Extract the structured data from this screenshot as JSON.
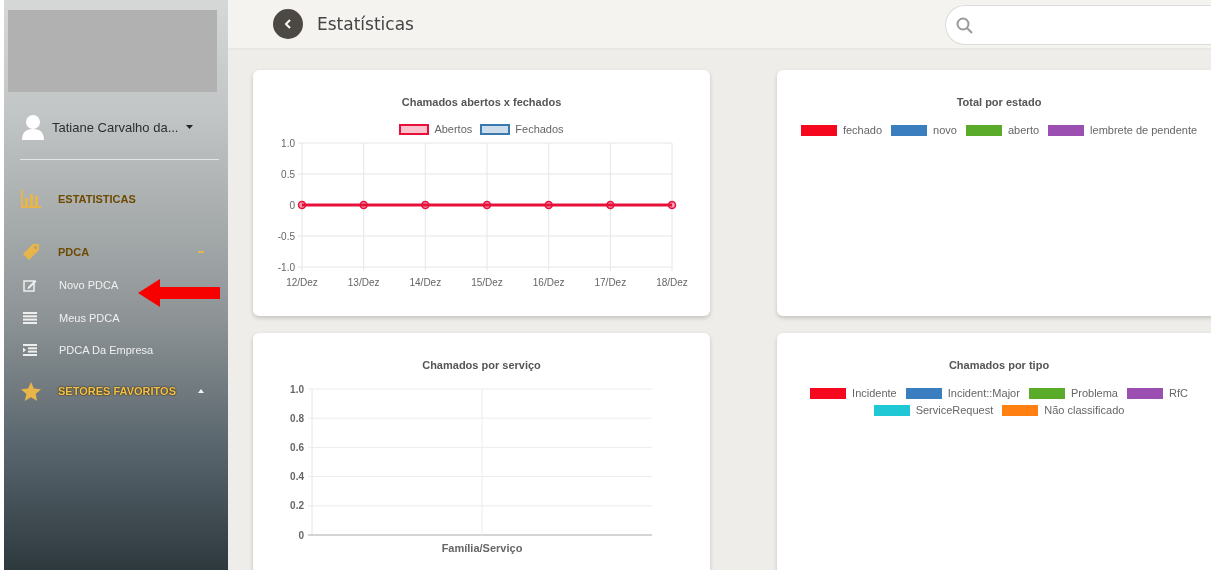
{
  "sidebar": {
    "user": {
      "name": "Tatiane Carvalho da..."
    },
    "items": [
      {
        "kind": "section",
        "label": "ESTATISTICAS"
      },
      {
        "kind": "section",
        "label": "PDCA",
        "expanded": true
      },
      {
        "kind": "link",
        "label": "Novo PDCA"
      },
      {
        "kind": "link",
        "label": "Meus PDCA"
      },
      {
        "kind": "link",
        "label": "PDCA Da Empresa"
      },
      {
        "kind": "section",
        "label": "SETORES FAVORITOS",
        "expanded": false
      }
    ]
  },
  "header": {
    "title": "Estatísticas"
  },
  "cards": [
    {
      "kind": "chart",
      "chart_data": {
        "type": "line",
        "title": "Chamados abertos x fechados",
        "categories": [
          "12/Dez",
          "13/Dez",
          "14/Dez",
          "15/Dez",
          "16/Dez",
          "17/Dez",
          "18/Dez"
        ],
        "ylim": [
          -1,
          1
        ],
        "yticks": [
          {
            "value": 1,
            "label": "1.0"
          },
          {
            "value": 0.5,
            "label": "0.5"
          },
          0,
          {
            "value": -0.5,
            "label": "-0.5"
          },
          {
            "value": -1,
            "label": "-1.0"
          }
        ],
        "grid": true,
        "legend": true,
        "series": [
          {
            "name": "Abertos",
            "color": "#e8103a",
            "marker": true,
            "values": [
              0,
              0,
              0,
              0,
              0,
              0,
              0
            ]
          },
          {
            "name": "Fechados",
            "color": "#3a78b0",
            "marker": true,
            "values": [
              null,
              null,
              null,
              null,
              null,
              null,
              null
            ]
          }
        ]
      }
    },
    {
      "kind": "legend",
      "title": "Total por estado",
      "legend": [
        {
          "label": "fechado",
          "color": "#f5081e"
        },
        {
          "label": "novo",
          "color": "#3a7ebf"
        },
        {
          "label": "aberto",
          "color": "#5aab2a"
        },
        {
          "label": "lembrete de pendente",
          "color": "#9b4fb0"
        }
      ]
    },
    {
      "kind": "chart",
      "chart_data": {
        "type": "bar",
        "title": "Chamados por serviço",
        "categories": [
          "Família/Serviço"
        ],
        "values": [
          0
        ],
        "grid": true,
        "ylim": [
          0,
          1
        ],
        "yticks": [
          {
            "value": 1,
            "label": "1.0"
          },
          {
            "value": 0.8,
            "label": "0.8"
          },
          {
            "value": 0.6,
            "label": "0.6"
          },
          {
            "value": 0.4,
            "label": "0.4"
          },
          {
            "value": 0.2,
            "label": "0.2"
          },
          0
        ]
      }
    },
    {
      "kind": "legend",
      "title": "Chamados por tipo",
      "legend": [
        {
          "label": "Incidente",
          "color": "#f5081e"
        },
        {
          "label": "Incident::Major",
          "color": "#3a7ebf"
        },
        {
          "label": "Problema",
          "color": "#5aab2a"
        },
        {
          "label": "RfC",
          "color": "#9b4fb0"
        },
        {
          "label": "ServiceRequest",
          "color": "#1fc8d4"
        },
        {
          "label": "Não classificado",
          "color": "#ff7f10"
        }
      ]
    }
  ]
}
